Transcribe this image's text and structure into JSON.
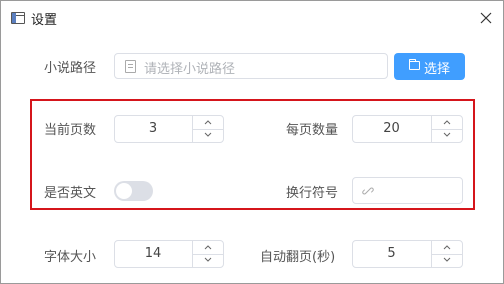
{
  "window": {
    "title": "设置"
  },
  "novel_path": {
    "label": "小说路径",
    "placeholder": "请选择小说路径",
    "button_label": "选择"
  },
  "page_number": {
    "label": "当前页数",
    "value": "3"
  },
  "per_page": {
    "label": "每页数量",
    "value": "20"
  },
  "english": {
    "label": "是否英文",
    "enabled": false
  },
  "line_separator": {
    "label": "换行符号",
    "value": ""
  },
  "font_size": {
    "label": "字体大小",
    "value": "14"
  },
  "auto_turn": {
    "label": "自动翻页(秒)",
    "value": "5"
  },
  "icons": {
    "app": "window-icon",
    "close": "close-icon",
    "document": "document-icon",
    "folder": "folder-icon",
    "chevron_up": "chevron-up-icon",
    "chevron_down": "chevron-down-icon",
    "link": "link-icon"
  },
  "colors": {
    "accent": "#409eff",
    "highlight_border": "#d5151b",
    "toggle_off": "#dcdfe6"
  }
}
